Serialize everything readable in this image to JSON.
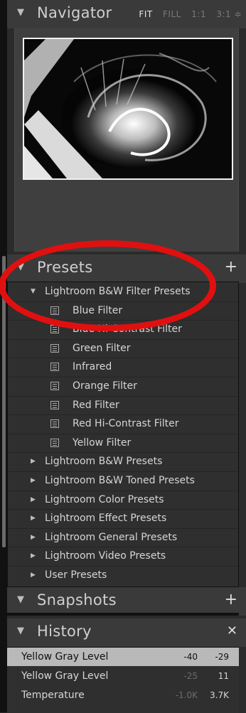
{
  "navigator": {
    "title": "Navigator",
    "zoom_options": [
      "FIT",
      "FILL",
      "1:1",
      "3:1 ≑"
    ],
    "active_zoom": "FIT"
  },
  "presets": {
    "title": "Presets",
    "add_symbol": "+",
    "expanded_folder": "Lightroom B&W Filter Presets",
    "items": [
      "Blue Filter",
      "Blue Hi-Contrast Filter",
      "Green Filter",
      "Infrared",
      "Orange Filter",
      "Red Filter",
      "Red Hi-Contrast Filter",
      "Yellow Filter"
    ],
    "folders": [
      "Lightroom B&W Presets",
      "Lightroom B&W Toned Presets",
      "Lightroom Color Presets",
      "Lightroom Effect Presets",
      "Lightroom General Presets",
      "Lightroom Video Presets",
      "User Presets"
    ]
  },
  "snapshots": {
    "title": "Snapshots",
    "add_symbol": "+"
  },
  "history": {
    "title": "History",
    "clear_symbol": "✕",
    "rows": [
      {
        "name": "Yellow Gray Level",
        "v1": "-40",
        "v2": "-29"
      },
      {
        "name": "Yellow Gray Level",
        "v1": "-25",
        "v2": "11"
      },
      {
        "name": "Temperature",
        "v1": "-1.0K",
        "v2": "3.7K"
      }
    ]
  },
  "colors": {
    "panel_bg": "#2b2b2b",
    "header_bg": "#3a3a3a",
    "highlight_circle": "#e01010",
    "selected_row": "#b9b9b9"
  }
}
